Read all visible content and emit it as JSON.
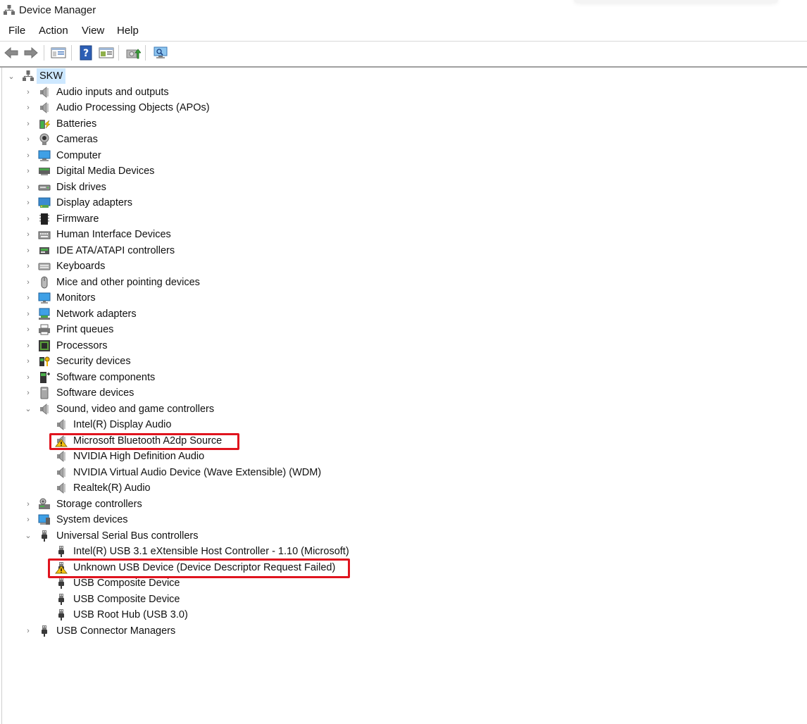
{
  "window": {
    "title": "Device Manager"
  },
  "menu": [
    "File",
    "Action",
    "View",
    "Help"
  ],
  "toolbar": {
    "buttons": [
      {
        "name": "back-arrow-icon"
      },
      {
        "name": "forward-arrow-icon"
      },
      {
        "name": "show-hide-console-tree-icon"
      },
      {
        "name": "help-icon"
      },
      {
        "name": "properties-pane-icon"
      },
      {
        "name": "update-driver-icon"
      },
      {
        "name": "scan-hardware-changes-icon"
      }
    ]
  },
  "tree": {
    "root": {
      "label": "SKW",
      "expanded": true
    },
    "categories": [
      {
        "label": "Audio inputs and outputs",
        "icon": "speaker-icon",
        "expanded": false
      },
      {
        "label": "Audio Processing Objects (APOs)",
        "icon": "speaker-icon",
        "expanded": false
      },
      {
        "label": "Batteries",
        "icon": "battery-icon",
        "expanded": false
      },
      {
        "label": "Cameras",
        "icon": "camera-icon",
        "expanded": false
      },
      {
        "label": "Computer",
        "icon": "computer-icon",
        "expanded": false
      },
      {
        "label": "Digital Media Devices",
        "icon": "media-device-icon",
        "expanded": false
      },
      {
        "label": "Disk drives",
        "icon": "disk-drive-icon",
        "expanded": false
      },
      {
        "label": "Display adapters",
        "icon": "display-adapter-icon",
        "expanded": false
      },
      {
        "label": "Firmware",
        "icon": "firmware-chip-icon",
        "expanded": false
      },
      {
        "label": "Human Interface Devices",
        "icon": "hid-icon",
        "expanded": false
      },
      {
        "label": "IDE ATA/ATAPI controllers",
        "icon": "ide-controller-icon",
        "expanded": false
      },
      {
        "label": "Keyboards",
        "icon": "keyboard-icon",
        "expanded": false
      },
      {
        "label": "Mice and other pointing devices",
        "icon": "mouse-icon",
        "expanded": false
      },
      {
        "label": "Monitors",
        "icon": "monitor-icon",
        "expanded": false
      },
      {
        "label": "Network adapters",
        "icon": "network-adapter-icon",
        "expanded": false
      },
      {
        "label": "Print queues",
        "icon": "printer-icon",
        "expanded": false
      },
      {
        "label": "Processors",
        "icon": "processor-icon",
        "expanded": false
      },
      {
        "label": "Security devices",
        "icon": "security-key-icon",
        "expanded": false
      },
      {
        "label": "Software components",
        "icon": "software-component-icon",
        "expanded": false
      },
      {
        "label": "Software devices",
        "icon": "software-device-icon",
        "expanded": false
      },
      {
        "label": "Sound, video and game controllers",
        "icon": "speaker-icon",
        "expanded": true,
        "children": [
          {
            "label": "Intel(R) Display Audio",
            "icon": "speaker-icon",
            "warning": false
          },
          {
            "label": "Microsoft Bluetooth A2dp Source",
            "icon": "speaker-warning-icon",
            "warning": true
          },
          {
            "label": "NVIDIA High Definition Audio",
            "icon": "speaker-icon",
            "warning": false
          },
          {
            "label": "NVIDIA Virtual Audio Device (Wave Extensible) (WDM)",
            "icon": "speaker-icon",
            "warning": false
          },
          {
            "label": "Realtek(R) Audio",
            "icon": "speaker-icon",
            "warning": false
          }
        ]
      },
      {
        "label": "Storage controllers",
        "icon": "storage-controller-icon",
        "expanded": false
      },
      {
        "label": "System devices",
        "icon": "system-device-icon",
        "expanded": false
      },
      {
        "label": "Universal Serial Bus controllers",
        "icon": "usb-plug-icon",
        "expanded": true,
        "children": [
          {
            "label": "Intel(R) USB 3.1 eXtensible Host Controller - 1.10 (Microsoft)",
            "icon": "usb-plug-icon",
            "warning": false
          },
          {
            "label": "Unknown USB Device (Device Descriptor Request Failed)",
            "icon": "usb-warning-icon",
            "warning": true
          },
          {
            "label": "USB Composite Device",
            "icon": "usb-plug-icon",
            "warning": false
          },
          {
            "label": "USB Composite Device",
            "icon": "usb-plug-icon",
            "warning": false
          },
          {
            "label": "USB Root Hub (USB 3.0)",
            "icon": "usb-plug-icon",
            "warning": false
          }
        ]
      },
      {
        "label": "USB Connector Managers",
        "icon": "usb-plug-icon",
        "expanded": false
      }
    ]
  },
  "colors": {
    "selection": "#cde8ff",
    "annotation_red": "#e0141e",
    "warning_yellow": "#f5c211"
  }
}
